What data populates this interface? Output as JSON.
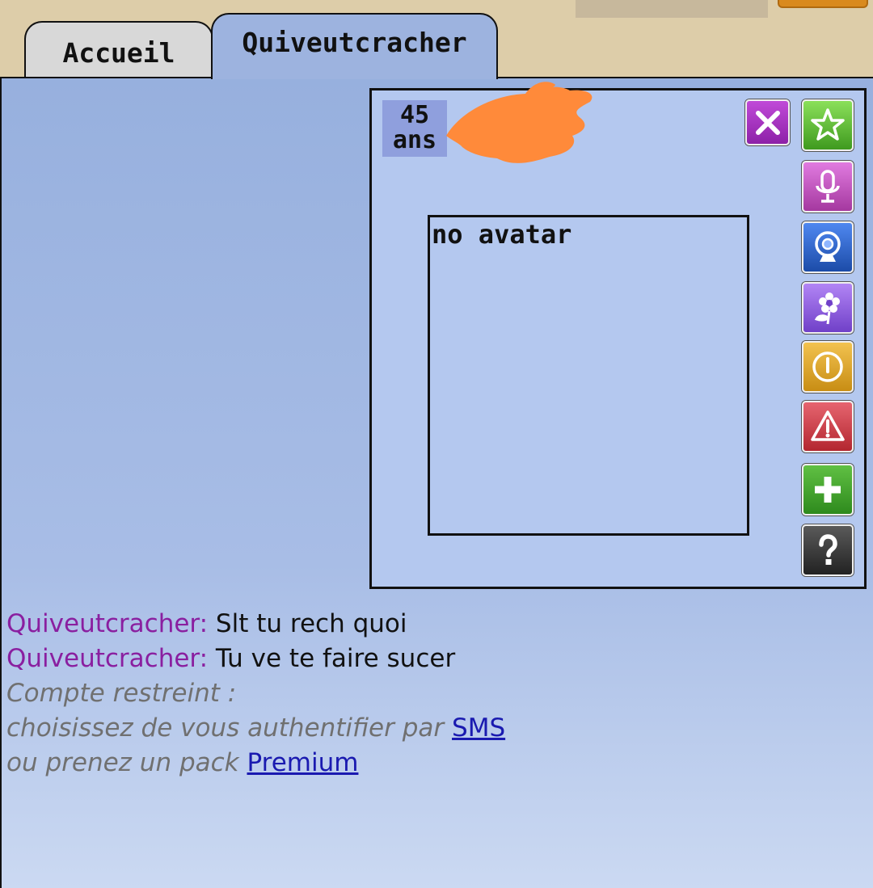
{
  "tabs": {
    "home_label": "Accueil",
    "user_label": "Quiveutcracher"
  },
  "profile": {
    "age_value": "45",
    "age_unit": "ans",
    "avatar_placeholder": "no avatar",
    "icons": [
      "close-icon",
      "star-icon",
      "microphone-icon",
      "webcam-icon",
      "flower-icon",
      "coin-icon",
      "warning-icon",
      "plus-icon",
      "help-icon"
    ]
  },
  "chat": {
    "messages": [
      {
        "sender": "Quiveutcracher:",
        "text": " Slt tu rech quoi"
      },
      {
        "sender": "Quiveutcracher:",
        "text": " Tu ve te faire sucer"
      }
    ],
    "notice": {
      "line1": "Compte restreint :",
      "line2_prefix": "choisissez de vous authentifier par ",
      "sms_link": "SMS",
      "line3_prefix": "ou prenez un pack ",
      "premium_link": "Premium"
    }
  },
  "colors": {
    "sender": "#8a1fa0",
    "redaction": "#ff8a3a",
    "panel_bg": "#b4c8ef",
    "link": "#1a1ab0"
  }
}
